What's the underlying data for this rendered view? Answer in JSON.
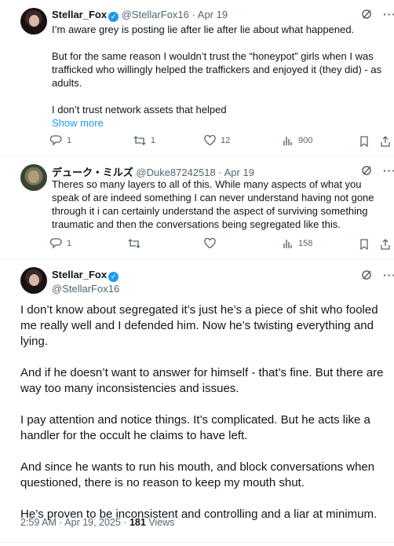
{
  "tweet1": {
    "display_name": "Stellar_Fox",
    "handle": "@StellarFox16",
    "date": "Apr 19",
    "lines": [
      "I’m aware grey is posting lie after lie after lie about what happened.",
      "But for the same reason I wouldn’t trust the “honeypot” girls when I was trafficked who willingly helped the traffickers and enjoyed it (they did) - as adults.",
      "I don’t trust network assets that helped"
    ],
    "show_more": "Show more",
    "replies": "1",
    "reposts": "1",
    "likes": "12",
    "views": "900"
  },
  "tweet2": {
    "display_name": "デューク・ミルズ",
    "handle": "@Duke87242518",
    "date": "Apr 19",
    "text": "Theres so many layers to all of this. While many aspects of what you speak of are indeed something I can never understand having not gone through it i can certainly understand the aspect of surviving something traumatic and then the conversations being segregated like this.",
    "replies": "1",
    "reposts": "",
    "likes": "",
    "views": "158"
  },
  "main_tweet": {
    "display_name": "Stellar_Fox",
    "handle": "@StellarFox16",
    "paragraphs": [
      "I don’t know about segregated it’s just he’s a piece of shit who fooled me really well and I defended him. Now he’s twisting everything and lying.",
      "And if he doesn’t want to answer for himself - that’s fine. But there are way too many inconsistencies and issues.",
      "I pay attention and notice things. It’s complicated. But he acts like a handler for the occult he claims to have left.",
      "And since he wants to run his mouth, and block conversations when questioned, there is no reason to keep my mouth shut.",
      "He’s proven to be inconsistent and controlling and a liar at minimum."
    ],
    "timestamp": "2:59 AM · Apr 19, 2025 · ",
    "views_count": "181",
    "views_label": " Views"
  },
  "colors": {
    "accent": "#1d9bf0",
    "muted": "#536471",
    "text": "#0f1419",
    "divider": "#eff3f4"
  },
  "icons": [
    "verified-badge-icon",
    "grok-icon",
    "more-icon",
    "reply-icon",
    "repost-icon",
    "like-icon",
    "views-icon",
    "bookmark-icon",
    "share-icon"
  ]
}
